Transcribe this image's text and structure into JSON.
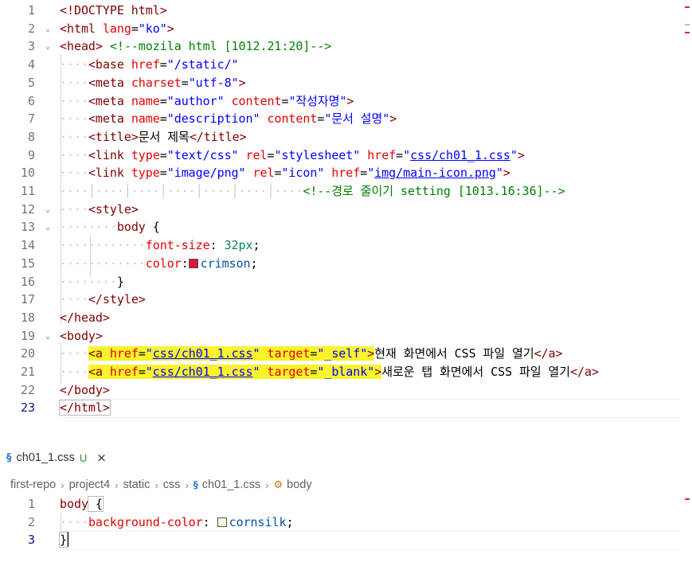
{
  "top_editor": {
    "line_numbers": [
      "1",
      "2",
      "3",
      "4",
      "5",
      "6",
      "7",
      "8",
      "9",
      "10",
      "11",
      "12",
      "13",
      "14",
      "15",
      "16",
      "17",
      "18",
      "19",
      "20",
      "21",
      "22",
      "23"
    ],
    "lines": [
      [
        "<!DOCTYPE html>"
      ],
      [
        "<html",
        " lang",
        "=",
        "\"ko\"",
        ">"
      ],
      [
        "<head>",
        " ",
        "<!--mozila html [1012.21:20]-->"
      ],
      [
        "<base",
        " href",
        "=",
        "\"/static/\""
      ],
      [
        "<meta",
        " charset",
        "=",
        "\"utf-8\"",
        ">"
      ],
      [
        "<meta",
        " name",
        "=",
        "\"author\"",
        " content",
        "=",
        "\"작성자명\"",
        ">"
      ],
      [
        "<meta",
        " name",
        "=",
        "\"description\"",
        " content",
        "=",
        "\"문서 설명\"",
        ">"
      ],
      [
        "<title>",
        "문서 제목",
        "</title>"
      ],
      [
        "<link",
        " type",
        "=",
        "\"text/css\"",
        " rel",
        "=",
        "\"stylesheet\"",
        " href",
        "=",
        "\"",
        "css/ch01_1.css",
        "\"",
        ">"
      ],
      [
        "<link",
        " type",
        "=",
        "\"image/png\"",
        " rel",
        "=",
        "\"icon\"",
        " href",
        "=",
        "\"",
        "img/main-icon.png",
        "\"",
        ">"
      ],
      [
        "<!--경로 줄이기 setting [1013.16:36]-->"
      ],
      [
        "<style>"
      ],
      [
        "body",
        " {"
      ],
      [
        "font-size",
        ": ",
        "32px",
        ";"
      ],
      [
        "color",
        ":",
        "crimson",
        ";"
      ],
      [
        "}"
      ],
      [
        "</style>"
      ],
      [
        "</head>"
      ],
      [
        "<body>"
      ],
      [
        "<a",
        " href",
        "=",
        "\"",
        "css/ch01_1.css",
        "\"",
        " target",
        "=",
        "\"_self\"",
        ">",
        "현재 화면에서 CSS 파일 열기",
        "</a>"
      ],
      [
        "<a",
        " href",
        "=",
        "\"",
        "css/ch01_1.css",
        "\"",
        " target",
        "=",
        "\"_blank\"",
        ">",
        "새로운 탭 화면에서 CSS 파일 열기",
        "</a>"
      ],
      [
        "</body>"
      ],
      [
        "</html>"
      ]
    ]
  },
  "tab": {
    "icon": "css-file-icon",
    "icon_glyph": "§",
    "label": "ch01_1.css",
    "status": "U",
    "close_glyph": "×"
  },
  "breadcrumb": {
    "items": [
      "first-repo",
      "project4",
      "static",
      "css",
      "ch01_1.css",
      "body"
    ],
    "separator": "›"
  },
  "bottom_editor": {
    "line_numbers": [
      "1",
      "2",
      "3"
    ],
    "lines": [
      [
        "body",
        " {"
      ],
      [
        "background-color",
        ": ",
        "cornsilk",
        ";"
      ],
      [
        "}"
      ]
    ]
  },
  "colors": {
    "crimson": "#dc143c",
    "cornsilk": "#fff8dc",
    "highlight": "#f8f32b",
    "tag": "#800000",
    "attribute": "#e50000",
    "string": "#0000ff",
    "comment": "#008000"
  }
}
